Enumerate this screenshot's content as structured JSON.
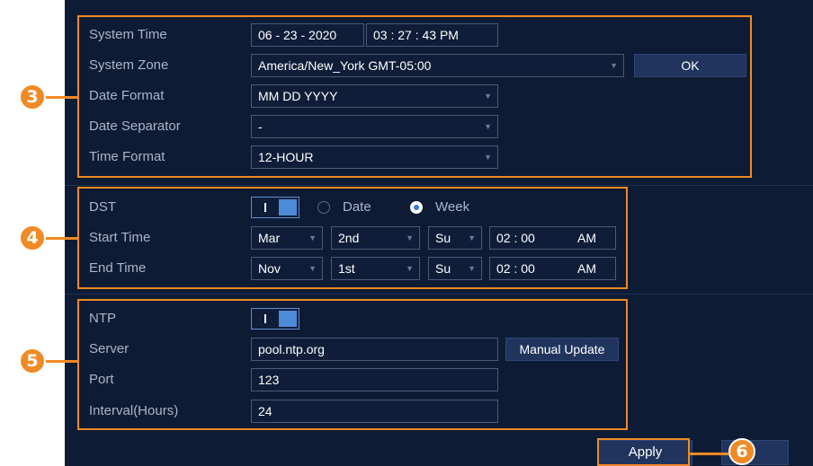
{
  "system": {
    "time_label": "System Time",
    "date_value": "06 - 23 - 2020",
    "time_value": "03 : 27 : 43 PM",
    "zone_label": "System Zone",
    "zone_value": "America/New_York GMT-05:00",
    "ok_label": "OK",
    "date_format_label": "Date Format",
    "date_format_value": "MM DD YYYY",
    "date_separator_label": "Date Separator",
    "date_separator_value": "-",
    "time_format_label": "Time Format",
    "time_format_value": "12-HOUR"
  },
  "dst": {
    "label": "DST",
    "enabled": true,
    "mode_date_label": "Date",
    "mode_week_label": "Week",
    "selected_mode": "Week",
    "start_label": "Start Time",
    "start_month": "Mar",
    "start_week": "2nd",
    "start_day": "Su",
    "start_time": "02 : 00",
    "start_ampm": "AM",
    "end_label": "End Time",
    "end_month": "Nov",
    "end_week": "1st",
    "end_day": "Su",
    "end_time": "02 : 00",
    "end_ampm": "AM"
  },
  "ntp": {
    "label": "NTP",
    "enabled": true,
    "server_label": "Server",
    "server_value": "pool.ntp.org",
    "manual_update_label": "Manual Update",
    "port_label": "Port",
    "port_value": "123",
    "interval_label": "Interval(Hours)",
    "interval_value": "24"
  },
  "footer": {
    "apply_label": "Apply"
  },
  "callouts": {
    "system": "3",
    "dst": "4",
    "ntp": "5",
    "apply": "6"
  },
  "colors": {
    "panel_bg": "#0e1b34",
    "accent": "#f08a24",
    "toggle_blue": "#4d8ad8"
  }
}
